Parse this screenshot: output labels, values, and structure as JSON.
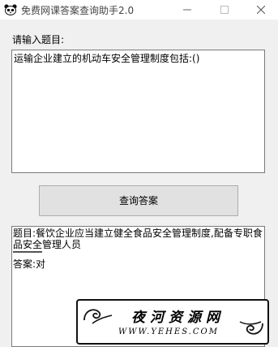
{
  "window": {
    "title": "免费网课答案查询助手2.0",
    "icons": {
      "app": "panda-icon",
      "minimize": "minimize-icon",
      "maximize": "maximize-icon",
      "close": "close-icon"
    }
  },
  "form": {
    "prompt_label": "请输入题目:",
    "question_value": "运输企业建立的机动车安全管理制度包括:()",
    "query_button_label": "查询答案"
  },
  "result": {
    "question_line": "题目:餐饮企业应当建立健全食品安全管理制度,配备专职食品安全管理人员",
    "answer_line": "答案:对"
  },
  "watermark": {
    "cn_text": "夜河资源网",
    "en_text": "WWW.YEHES.COM"
  }
}
